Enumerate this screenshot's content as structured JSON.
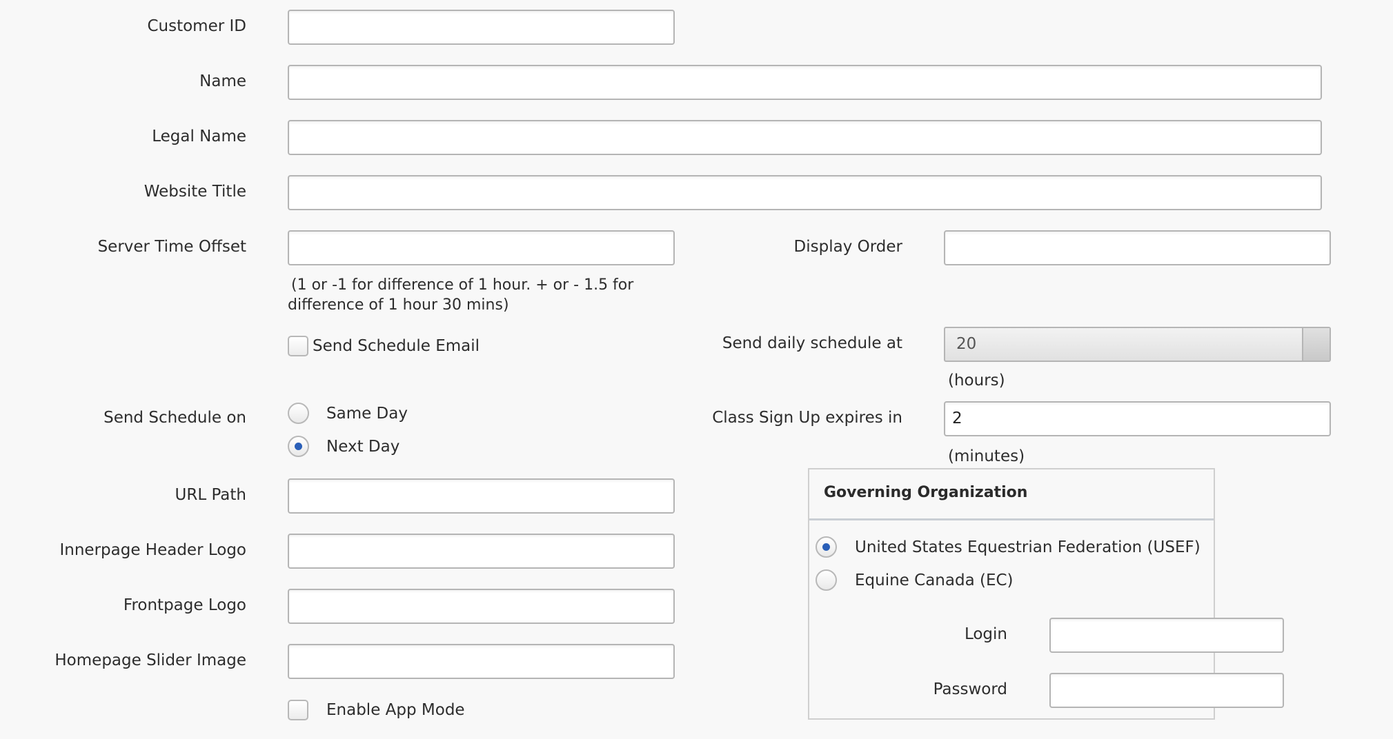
{
  "fields": {
    "customer_id": {
      "label": "Customer ID",
      "value": ""
    },
    "name": {
      "label": "Name",
      "value": ""
    },
    "legal_name": {
      "label": "Legal Name",
      "value": ""
    },
    "website_title": {
      "label": "Website Title",
      "value": ""
    },
    "server_time_offset": {
      "label": "Server Time Offset",
      "value": "",
      "help": "(1 or -1 for difference of 1 hour. + or - 1.5 for difference of 1 hour 30 mins)"
    },
    "display_order": {
      "label": "Display Order",
      "value": ""
    },
    "send_schedule_email": {
      "label": "Send Schedule Email",
      "checked": false
    },
    "send_daily_schedule_at": {
      "label": "Send daily schedule at",
      "value": "20",
      "unit": "(hours)"
    },
    "send_schedule_on": {
      "label": "Send Schedule on",
      "options": [
        {
          "label": "Same Day",
          "selected": false
        },
        {
          "label": "Next Day",
          "selected": true
        }
      ]
    },
    "class_sign_up_expires": {
      "label": "Class Sign Up expires in",
      "value": "2",
      "unit": "(minutes)"
    },
    "url_path": {
      "label": "URL Path",
      "value": ""
    },
    "innerpage_header_logo": {
      "label": "Innerpage Header Logo",
      "value": ""
    },
    "frontpage_logo": {
      "label": "Frontpage Logo",
      "value": ""
    },
    "homepage_slider_image": {
      "label": "Homepage Slider Image",
      "value": ""
    },
    "enable_app_mode": {
      "label": "Enable App Mode",
      "checked": false
    }
  },
  "governing_organization": {
    "title": "Governing Organization",
    "options": [
      {
        "label": "United States Equestrian Federation (USEF)",
        "selected": true
      },
      {
        "label": "Equine Canada (EC)",
        "selected": false
      }
    ],
    "login": {
      "label": "Login",
      "value": ""
    },
    "password": {
      "label": "Password",
      "value": ""
    }
  },
  "colors": {
    "background": "#f8f8f8",
    "radio_selected": "#2a5fb8",
    "input_border": "#b5b5b5"
  }
}
